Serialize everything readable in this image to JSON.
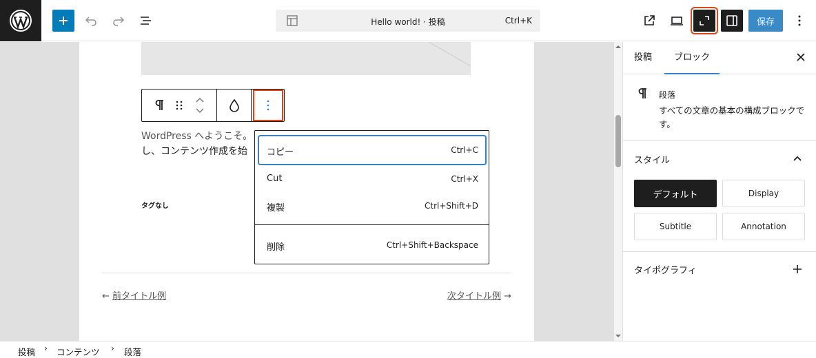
{
  "header": {
    "command_title": "Hello world! · 投稿",
    "command_shortcut": "Ctrl+K",
    "save_label": "保存"
  },
  "editor": {
    "paragraph_line1": "WordPress へようこそ。",
    "paragraph_line2": "し、コンテンツ作成を始",
    "tags_label": "タグなし",
    "prev_arrow": "←",
    "prev_prefix": "前",
    "prev_title": "タイトル例",
    "next_prefix": "次",
    "next_title": "タイトル例",
    "next_arrow": "→"
  },
  "options_menu": {
    "items": [
      {
        "label": "コピー",
        "shortcut": "Ctrl+C"
      },
      {
        "label": "Cut",
        "shortcut": "Ctrl+X"
      },
      {
        "label": "複製",
        "shortcut": "Ctrl+Shift+D"
      },
      {
        "label": "削除",
        "shortcut": "Ctrl+Shift+Backspace"
      }
    ]
  },
  "sidebar": {
    "tabs": [
      {
        "label": "投稿"
      },
      {
        "label": "ブロック"
      }
    ],
    "block": {
      "title": "段落",
      "description": "すべての文章の基本の構成ブロックです。"
    },
    "styles_heading": "スタイル",
    "styles": [
      {
        "label": "デフォルト"
      },
      {
        "label": "Display"
      },
      {
        "label": "Subtitle"
      },
      {
        "label": "Annotation"
      }
    ],
    "typography_heading": "タイポグラフィ"
  },
  "breadcrumb": {
    "items": [
      "投稿",
      "コンテンツ",
      "段落"
    ],
    "separator": "›"
  },
  "colors": {
    "accent": "#007cba",
    "highlight": "#d9471a",
    "dark": "#1e1e1e"
  }
}
